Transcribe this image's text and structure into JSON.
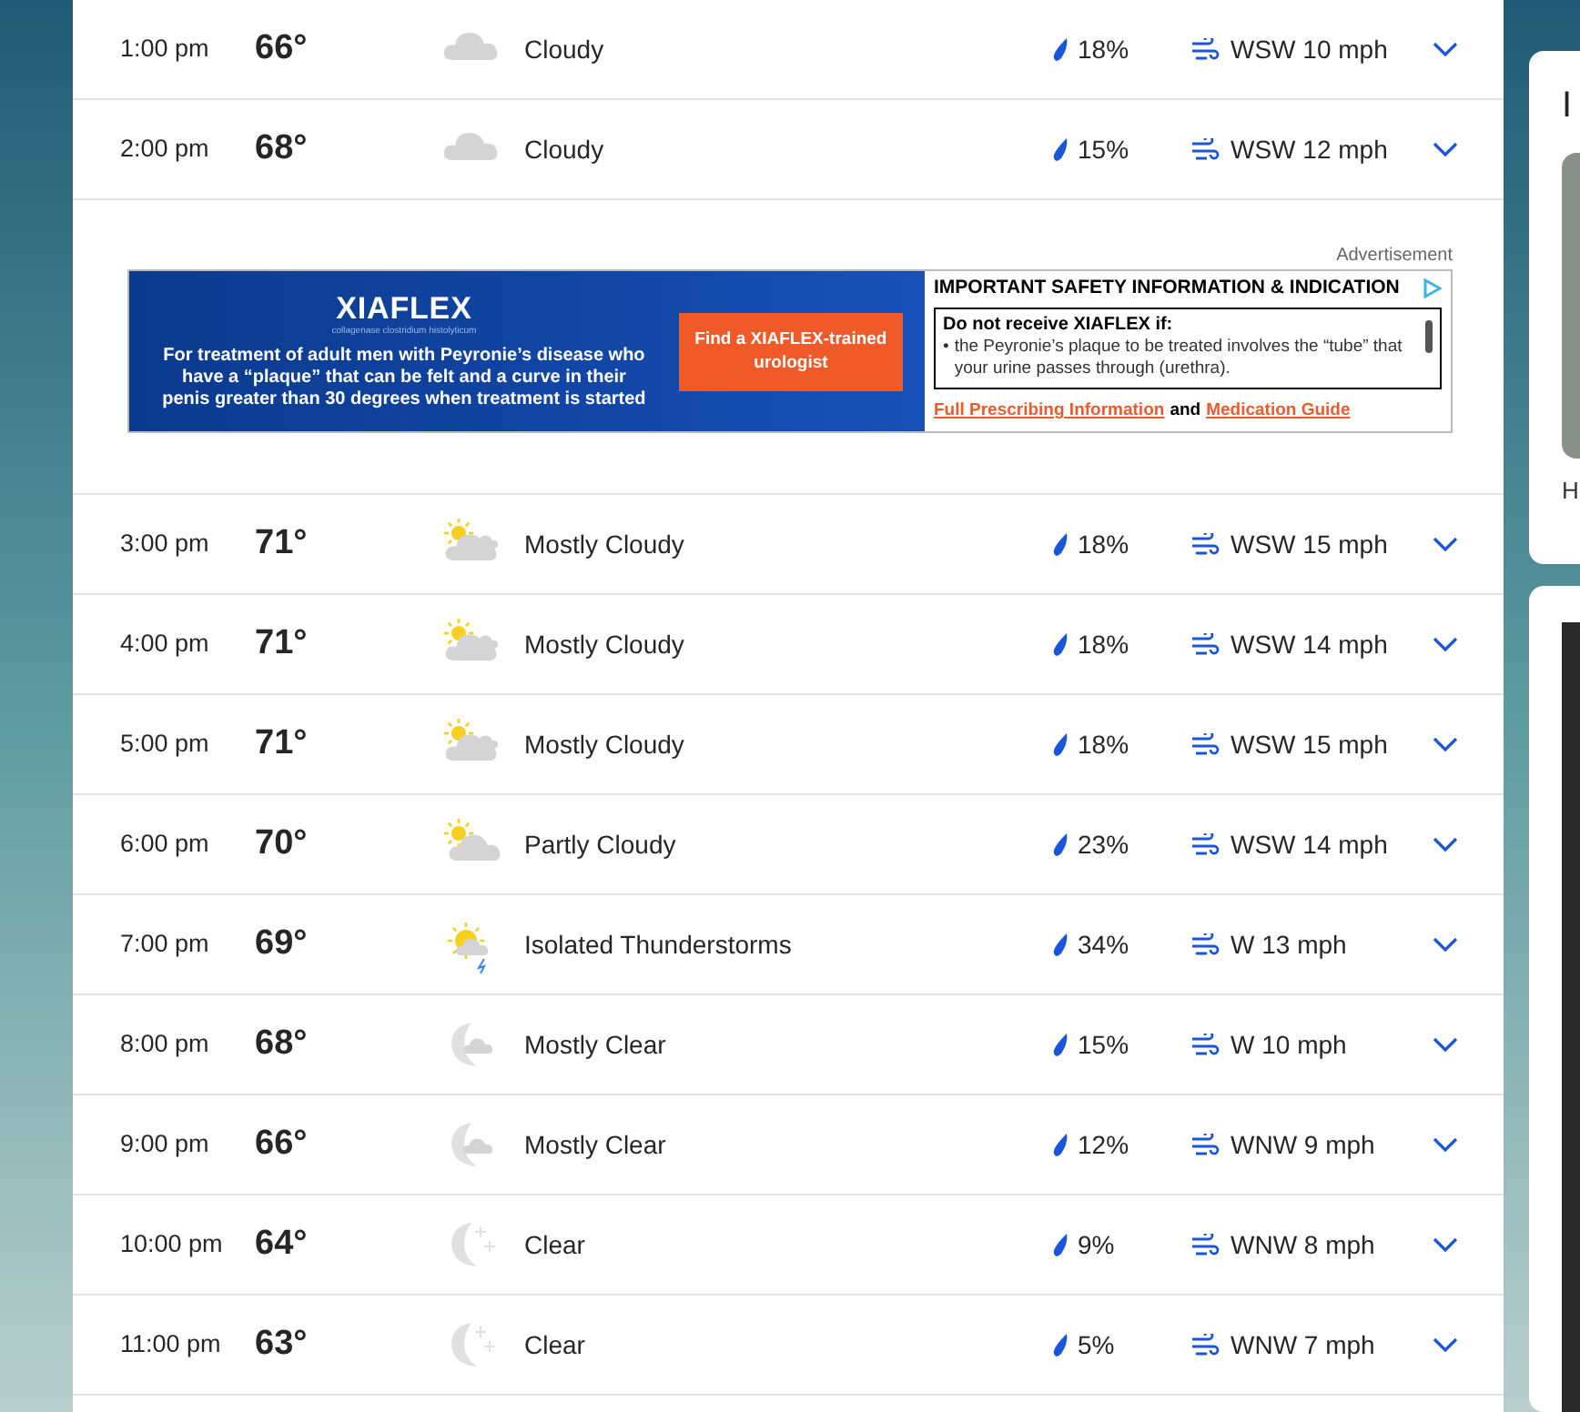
{
  "hours_before_ad": [
    {
      "time": "1:00 pm",
      "temp": "66°",
      "kind": "cloudy",
      "condition": "Cloudy",
      "precip": "18%",
      "wind": "WSW 10 mph"
    },
    {
      "time": "2:00 pm",
      "temp": "68°",
      "kind": "cloudy",
      "condition": "Cloudy",
      "precip": "15%",
      "wind": "WSW 12 mph"
    }
  ],
  "ad": {
    "label": "Advertisement",
    "brand": "XIAFLEX",
    "brand_sub": "collagenase clostridium histolyticum",
    "claim": "For treatment of adult men with Peyronie’s disease who have a “plaque” that can be felt and a curve in their penis greater than 30 degrees when treatment is started",
    "cta": "Find a XIAFLEX-trained urologist",
    "safety_title": "IMPORTANT SAFETY INFORMATION & INDICATION",
    "box_title": "Do not receive XIAFLEX if:",
    "bullet_mark": "•",
    "bullet": "the Peyronie’s plaque to be treated involves the “tube” that your urine passes through (urethra).",
    "link_1": "Full Prescribing Information",
    "joiner": "and",
    "link_2": "Medication Guide"
  },
  "hours_after_ad": [
    {
      "time": "3:00 pm",
      "temp": "71°",
      "kind": "mostly_cloudy",
      "condition": "Mostly Cloudy",
      "precip": "18%",
      "wind": "WSW 15 mph"
    },
    {
      "time": "4:00 pm",
      "temp": "71°",
      "kind": "mostly_cloudy",
      "condition": "Mostly Cloudy",
      "precip": "18%",
      "wind": "WSW 14 mph"
    },
    {
      "time": "5:00 pm",
      "temp": "71°",
      "kind": "mostly_cloudy",
      "condition": "Mostly Cloudy",
      "precip": "18%",
      "wind": "WSW 15 mph"
    },
    {
      "time": "6:00 pm",
      "temp": "70°",
      "kind": "partly_cloudy",
      "condition": "Partly Cloudy",
      "precip": "23%",
      "wind": "WSW 14 mph"
    },
    {
      "time": "7:00 pm",
      "temp": "69°",
      "kind": "thunder",
      "condition": "Isolated Thunderstorms",
      "precip": "34%",
      "wind": "W 13 mph"
    },
    {
      "time": "8:00 pm",
      "temp": "68°",
      "kind": "mostly_clear_night",
      "condition": "Mostly Clear",
      "precip": "15%",
      "wind": "W 10 mph"
    },
    {
      "time": "9:00 pm",
      "temp": "66°",
      "kind": "mostly_clear_night",
      "condition": "Mostly Clear",
      "precip": "12%",
      "wind": "WNW 9 mph"
    },
    {
      "time": "10:00 pm",
      "temp": "64°",
      "kind": "clear_night",
      "condition": "Clear",
      "precip": "9%",
      "wind": "WNW 8 mph"
    },
    {
      "time": "11:00 pm",
      "temp": "63°",
      "kind": "clear_night",
      "condition": "Clear",
      "precip": "5%",
      "wind": "WNW 7 mph"
    }
  ],
  "side_card": {
    "title": "I",
    "caption": "H"
  }
}
